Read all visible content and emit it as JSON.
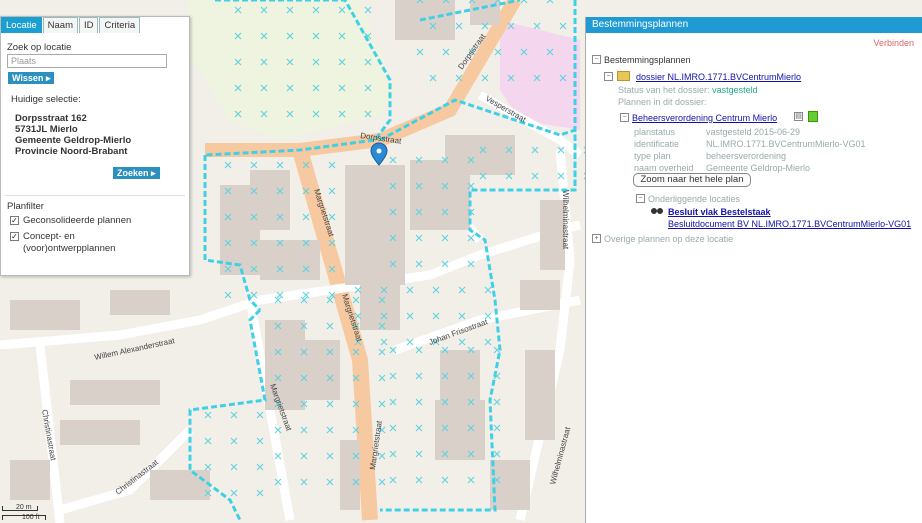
{
  "left_panel": {
    "tabs": [
      "Locatie",
      "Naam",
      "ID",
      "Criteria"
    ],
    "search_label": "Zoek op locatie",
    "search_placeholder": "Plaats",
    "show_button": "Wissen",
    "selection_label": "Huidige selectie:",
    "address_lines": [
      "Dorpsstraat 162",
      "5731JL Mierlo",
      "Gemeente Geldrop-Mierlo",
      "Provincie Noord-Brabant"
    ],
    "search_button": "Zoeken",
    "filter_label": "Planfilter",
    "filters": [
      {
        "label": "Geconsolideerde plannen",
        "checked": true
      },
      {
        "label": "Concept- en",
        "label2": "(voor)ontwerpplannen",
        "checked": true
      }
    ]
  },
  "right_panel": {
    "title": "Bestemmingsplannen",
    "top_right_label": "Verbinden",
    "tree_root": "Bestemmingsplannen",
    "dossier_link": "dossier NL.IMRO.1771.BVCentrumMierlo",
    "status_line": "Status van het dossier:",
    "status_value": "vastgesteld",
    "plans_line": "Plannen in dit dossier:",
    "plan_title": "Beheersverordening Centrum Mierlo",
    "details": [
      {
        "key": "planstatus",
        "value": "vastgesteld 2015-06-29"
      },
      {
        "key": "identificatie",
        "value": "NL.IMRO.1771.BVCentrumMierlo-VG01"
      },
      {
        "key": "type plan",
        "value": "beheersverordening"
      },
      {
        "key": "naam overheid",
        "value": "Gemeente Geldrop-Mierlo"
      }
    ],
    "zoom_button": "Zoom naar het hele plan",
    "sublevel": "Onderliggende locaties",
    "sub_item_1": "Besluit vlak Bestelstaak",
    "sub_item_2": "Besluitdocument BV NL.IMRO.1771.BVCentrumMierlo-VG01",
    "footer_link": "Overige plannen op deze locatie"
  },
  "map": {
    "streets": [
      "Dorpsstraat",
      "Dorpsstraat",
      "Vesperstraat",
      "Margrietstraat",
      "Margrietstraat",
      "Wilhelminastraat",
      "Willem Alexanderstraat",
      "Johan Frisostraat",
      "Margrietstraat",
      "Christinastraat",
      "Christinastraat",
      "Wilhelminastraat",
      "Margrietstraat"
    ],
    "scale_top": "20 m",
    "scale_bottom": "100 ft",
    "colors": {
      "plan_outline": "#3ed0e6",
      "road": "#f7c9a0",
      "building": "#d9d0c9",
      "highlight": "#f4d6ee"
    }
  }
}
